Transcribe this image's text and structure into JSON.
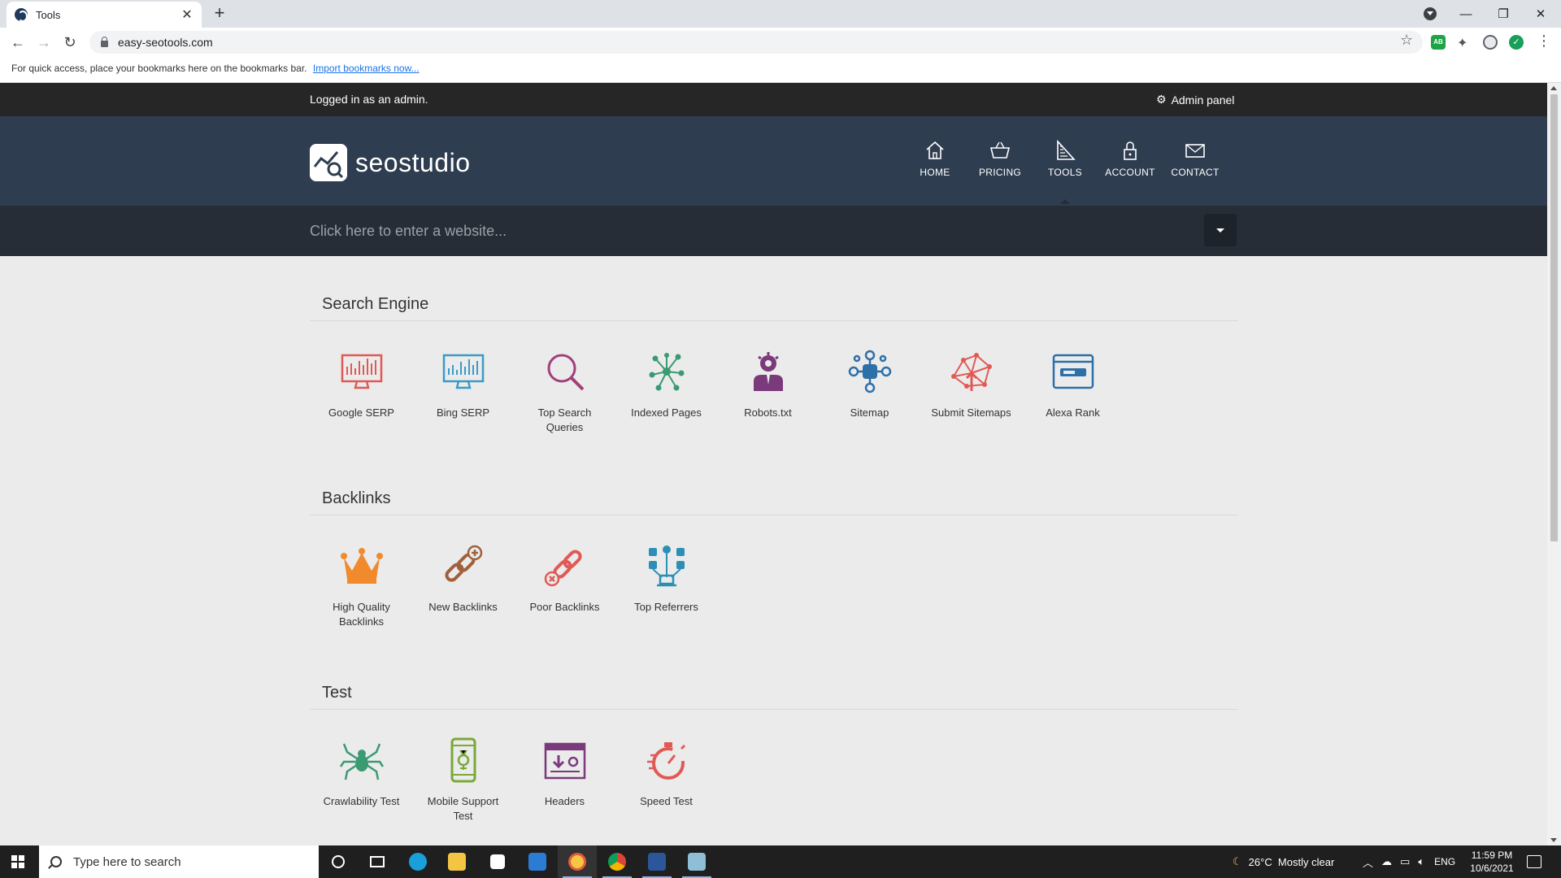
{
  "browser": {
    "tab_title": "Tools",
    "url": "easy-seotools.com",
    "bookmarks_text": "For quick access, place your bookmarks here on the bookmarks bar.",
    "bookmarks_link": "Import bookmarks now...",
    "ext_ab_label": "AB"
  },
  "site": {
    "admin_text": "Logged in as an admin.",
    "admin_panel": "Admin panel",
    "logo_text": "seostudio",
    "nav": [
      {
        "label": "HOME",
        "icon": "home-icon"
      },
      {
        "label": "PRICING",
        "icon": "basket-icon"
      },
      {
        "label": "TOOLS",
        "icon": "tools-icon",
        "active": true
      },
      {
        "label": "ACCOUNT",
        "icon": "lock-icon"
      },
      {
        "label": "CONTACT",
        "icon": "mail-icon"
      }
    ],
    "search_placeholder": "Click here to enter a website..."
  },
  "sections": [
    {
      "title": "Search Engine",
      "tools": [
        {
          "name": "Google SERP",
          "icon": "monitor-chart-icon",
          "color": "#e05a55"
        },
        {
          "name": "Bing SERP",
          "icon": "monitor-chart-icon",
          "color": "#3a9bc8"
        },
        {
          "name": "Top Search Queries",
          "icon": "magnifier-icon",
          "color": "#a0407a"
        },
        {
          "name": "Indexed Pages",
          "icon": "network-icon",
          "color": "#3a9a72"
        },
        {
          "name": "Robots.txt",
          "icon": "robot-icon",
          "color": "#7b3a7b"
        },
        {
          "name": "Sitemap",
          "icon": "sitemap-icon",
          "color": "#2d6fa8"
        },
        {
          "name": "Submit Sitemaps",
          "icon": "submit-sitemap-icon",
          "color": "#e05a55"
        },
        {
          "name": "Alexa Rank",
          "icon": "browser-window-icon",
          "color": "#2d6fa8"
        }
      ]
    },
    {
      "title": "Backlinks",
      "tools": [
        {
          "name": "High Quality Backlinks",
          "icon": "crown-icon",
          "color": "#f08a2c"
        },
        {
          "name": "New Backlinks",
          "icon": "link-plus-icon",
          "color": "#a0603c"
        },
        {
          "name": "Poor Backlinks",
          "icon": "link-cross-icon",
          "color": "#e05a55"
        },
        {
          "name": "Top Referrers",
          "icon": "social-referrers-icon",
          "color": "#2d8fb8"
        }
      ]
    },
    {
      "title": "Test",
      "tools": [
        {
          "name": "Crawlability Test",
          "icon": "spider-icon",
          "color": "#3a9a72"
        },
        {
          "name": "Mobile Support Test",
          "icon": "mobile-icon",
          "color": "#7aa83a"
        },
        {
          "name": "Headers",
          "icon": "headers-icon",
          "color": "#7b3a7b"
        },
        {
          "name": "Speed Test",
          "icon": "stopwatch-icon",
          "color": "#e05a55"
        }
      ]
    }
  ],
  "taskbar": {
    "search_placeholder": "Type here to search",
    "weather": "26°C  Mostly clear",
    "lang": "ENG",
    "time": "11:59 PM",
    "date": "10/6/2021"
  }
}
